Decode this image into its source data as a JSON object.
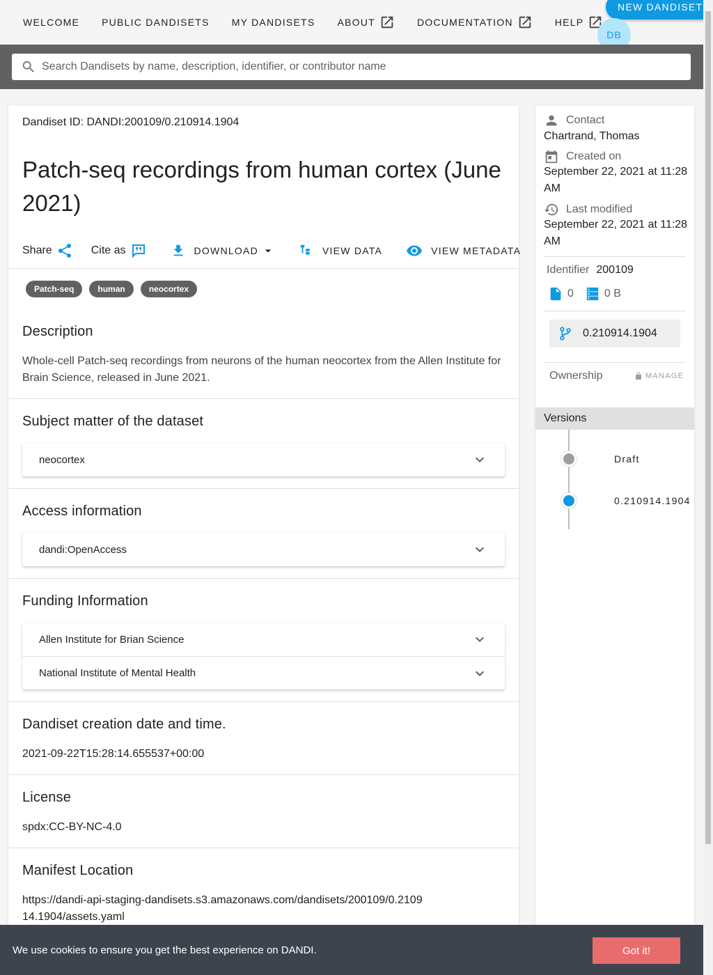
{
  "nav": {
    "items": [
      {
        "label": "Welcome",
        "external": false
      },
      {
        "label": "Public Dandisets",
        "external": false
      },
      {
        "label": "My Dandisets",
        "external": false
      },
      {
        "label": "About",
        "external": true
      },
      {
        "label": "Documentation",
        "external": true
      },
      {
        "label": "Help",
        "external": true
      }
    ],
    "new_dandiset_label": "New Dandiset",
    "avatar_initials": "DB"
  },
  "search": {
    "placeholder": "Search Dandisets by name, description, identifier, or contributor name",
    "value": ""
  },
  "dandiset": {
    "id_line": "Dandiset ID: DANDI:200109/0.210914.1904",
    "title": "Patch-seq recordings from human cortex (June 2021)",
    "actions": {
      "share": "Share",
      "cite": "Cite as",
      "download": "Download",
      "view_data": "View Data",
      "view_metadata": "View Metadata"
    },
    "keywords": [
      "Patch-seq",
      "human",
      "neocortex"
    ],
    "description_heading": "Description",
    "description": "Whole-cell Patch-seq recordings from neurons of the human neocortex from the Allen Institute for Brain Science, released in June 2021.",
    "subject_heading": "Subject matter of the dataset",
    "subject_items": [
      "neocortex"
    ],
    "access_heading": "Access information",
    "access_items": [
      "dandi:OpenAccess"
    ],
    "funding_heading": "Funding Information",
    "funding_items": [
      "Allen Institute for Brian Science",
      "National Institute of Mental Health"
    ],
    "creation_heading": "Dandiset creation date and time.",
    "creation_value": "2021-09-22T15:28:14.655537+00:00",
    "license_heading": "License",
    "license_value": "spdx:CC-BY-NC-4.0",
    "manifest_heading": "Manifest Location",
    "manifest_value": "https://dandi-api-staging-dandisets.s3.amazonaws.com/dandisets/200109/0.210914.1904/assets.yaml"
  },
  "sidebar": {
    "contact_label": "Contact",
    "contact_value": "Chartrand, Thomas",
    "created_label": "Created on",
    "created_value": "September 22, 2021 at 11:28 AM",
    "modified_label": "Last modified",
    "modified_value": "September 22, 2021 at 11:28 AM",
    "identifier_label": "Identifier",
    "identifier_value": "200109",
    "file_count": "0",
    "size": "0 B",
    "current_version": "0.210914.1904",
    "ownership_label": "Ownership",
    "manage_label": "Manage",
    "versions_heading": "Versions",
    "versions": [
      {
        "label": "Draft",
        "color": "#9e9e9e"
      },
      {
        "label": "0.210914.1904",
        "color": "#0e9ae0"
      }
    ]
  },
  "cookie": {
    "text": "We use cookies to ensure you get the best experience on DANDI.",
    "button": "Got it!"
  },
  "colors": {
    "accent": "#0e9ae0",
    "chip": "#616161",
    "cookie_bar": "#3e444d",
    "cookie_button": "#e96c6c"
  }
}
